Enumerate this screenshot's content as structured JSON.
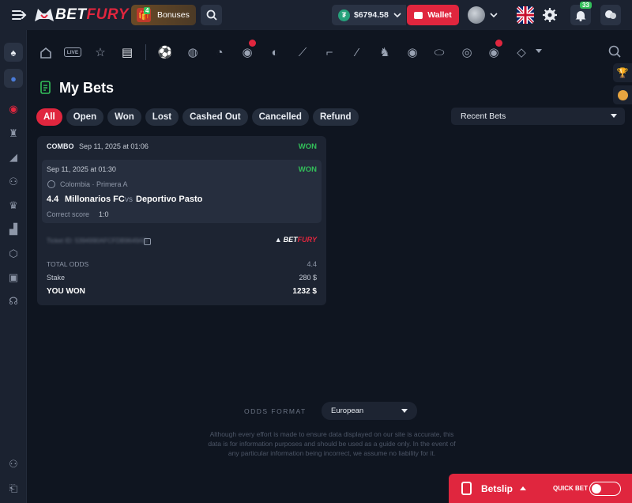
{
  "header": {
    "brand_left": "BET",
    "brand_right": "FURY",
    "bonuses_label": "Bonuses",
    "bonus_count": "4",
    "balance": "$6794.58",
    "balance_currency_symbol": "₮",
    "wallet_label": "Wallet",
    "notifications_count": "33"
  },
  "page": {
    "title": "My Bets",
    "filters": [
      "All",
      "Open",
      "Won",
      "Lost",
      "Cashed Out",
      "Cancelled",
      "Refund"
    ],
    "active_filter": "All",
    "sort_select": "Recent Bets"
  },
  "bet": {
    "type": "COMBO",
    "date": "Sep 11, 2025 at 01:06",
    "status": "WON",
    "selection": {
      "date": "Sep 11, 2025 at 01:30",
      "status": "WON",
      "league": "Colombia · Primera A",
      "odds": "4.4",
      "home": "Millonarios FC",
      "vs": "vs",
      "away": "Deportivo Pasto",
      "market": "Correct score",
      "pick": "1:0"
    },
    "ticket_id": "Ticket ID: 5394990AFCFDB9649AD",
    "total_odds_label": "TOTAL ODDS",
    "total_odds": "4.4",
    "stake_label": "Stake",
    "stake": "280 $",
    "won_label": "YOU WON",
    "won": "1232 $"
  },
  "footer": {
    "odds_format_label": "ODDS FORMAT",
    "odds_format": "European",
    "disclaimer_1": "Although every effort is made to ensure data displayed on our site is accurate, this",
    "disclaimer_2": "data is for information purposes and should be used as a guide only. In the event of",
    "disclaimer_3": "any particular information being incorrect, we assume no liability for it."
  },
  "betslip": {
    "label": "Betslip",
    "quick_bet_label": "QUICK BET"
  },
  "nav_live_label": "LIVE",
  "colors": {
    "accent": "#e0263e",
    "won": "#33c05a",
    "bg": "#0f1520",
    "panel": "#1b2230"
  }
}
